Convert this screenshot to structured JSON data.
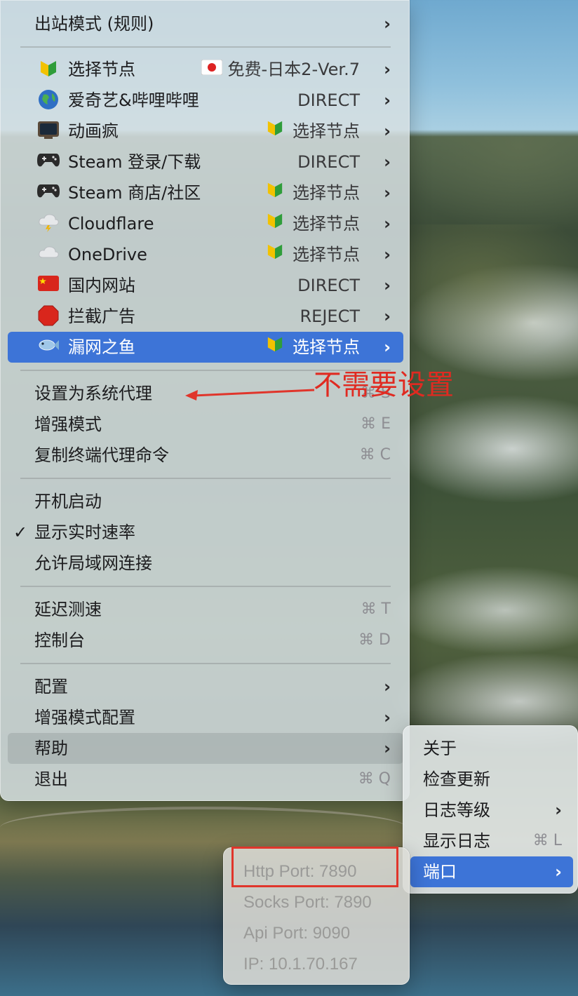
{
  "main_menu": {
    "outbound_mode": "出站模式 (规则)",
    "proxy_groups": [
      {
        "label": "选择节点",
        "icon": "beginner-leaf-icon",
        "value": "免费-日本2-Ver.7",
        "value_icon": "japan-flag-icon"
      },
      {
        "label": "爱奇艺&哔哩哔哩",
        "icon": "globe-icon",
        "value": "DIRECT",
        "value_icon": ""
      },
      {
        "label": "动画疯",
        "icon": "tv-icon",
        "value": "选择节点",
        "value_icon": "beginner-leaf-icon"
      },
      {
        "label": "Steam 登录/下载",
        "icon": "gamepad-icon",
        "value": "DIRECT",
        "value_icon": ""
      },
      {
        "label": "Steam 商店/社区",
        "icon": "gamepad-icon",
        "value": "选择节点",
        "value_icon": "beginner-leaf-icon"
      },
      {
        "label": "Cloudflare",
        "icon": "cloud-lightning-icon",
        "value": "选择节点",
        "value_icon": "beginner-leaf-icon"
      },
      {
        "label": "OneDrive",
        "icon": "cloud-icon",
        "value": "选择节点",
        "value_icon": "beginner-leaf-icon"
      },
      {
        "label": "国内网站",
        "icon": "china-flag-icon",
        "value": "DIRECT",
        "value_icon": ""
      },
      {
        "label": "拦截广告",
        "icon": "stop-sign-icon",
        "value": "REJECT",
        "value_icon": ""
      },
      {
        "label": "漏网之鱼",
        "icon": "fish-icon",
        "value": "选择节点",
        "value_icon": "beginner-leaf-icon"
      }
    ],
    "set_system_proxy": {
      "label": "设置为系统代理",
      "shortcut": "⌘ S"
    },
    "enhanced_mode": {
      "label": "增强模式",
      "shortcut": "⌘ E"
    },
    "copy_terminal": {
      "label": "复制终端代理命令",
      "shortcut": "⌘ C"
    },
    "launch_at_login": "开机启动",
    "show_speed": "显示实时速率",
    "allow_lan": "允许局域网连接",
    "latency_test": {
      "label": "延迟测速",
      "shortcut": "⌘ T"
    },
    "console": {
      "label": "控制台",
      "shortcut": "⌘ D"
    },
    "config": "配置",
    "enhanced_config": "增强模式配置",
    "help": "帮助",
    "quit": {
      "label": "退出",
      "shortcut": "⌘ Q"
    }
  },
  "help_submenu": {
    "about": "关于",
    "check_update": "检查更新",
    "log_level": "日志等级",
    "show_log": {
      "label": "显示日志",
      "shortcut": "⌘ L"
    },
    "port": "端口"
  },
  "port_submenu": {
    "http_port": "Http Port: 7890",
    "socks_port": "Socks Port: 7890",
    "api_port": "Api Port: 9090",
    "ip": "IP: 10.1.70.167"
  },
  "annotation": {
    "text": "不需要设置",
    "color": "#e02a21"
  },
  "colors": {
    "selection": "#3d74d7",
    "annotation": "#e02a21"
  },
  "check_mark": "✓",
  "chevron": "›"
}
